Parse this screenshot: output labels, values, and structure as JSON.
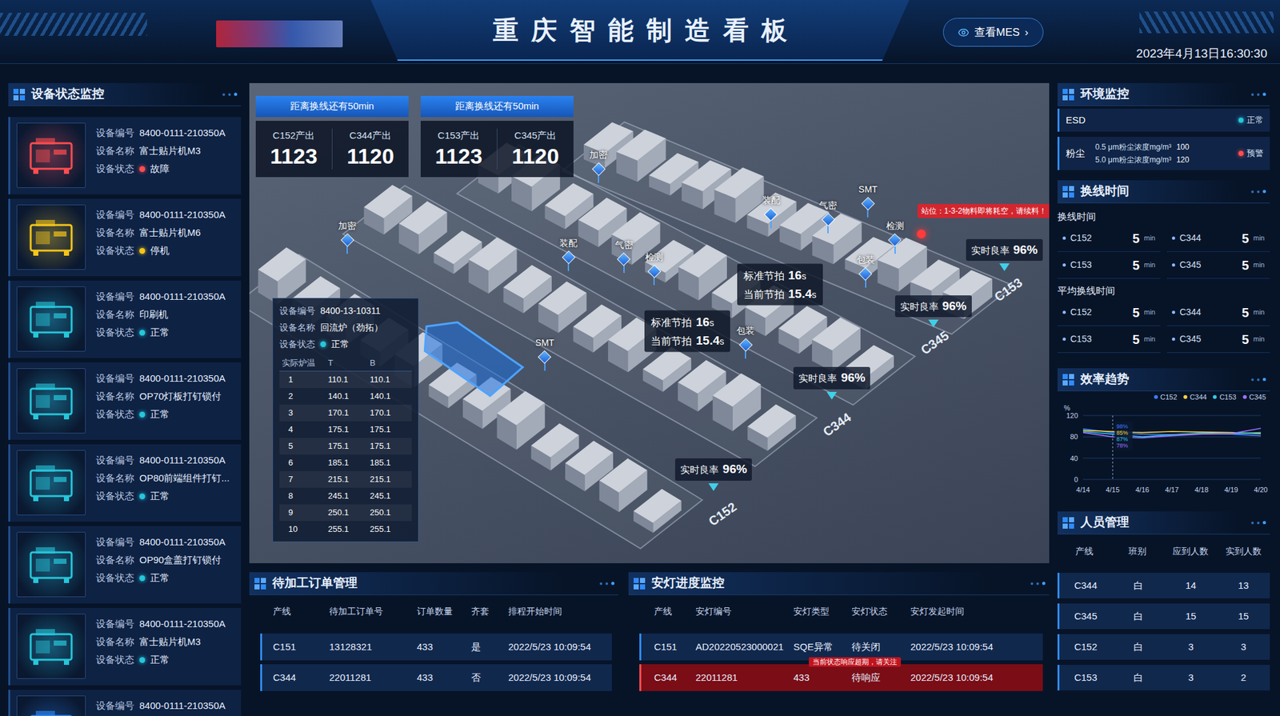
{
  "header": {
    "title": "重庆智能制造看板",
    "mes_button": {
      "label": "查看MES",
      "chevron": "›"
    },
    "datetime": "2023年4月13日16:30:30"
  },
  "device_panel": {
    "title": "设备状态监控",
    "labels": {
      "number": "设备编号",
      "name": "设备名称",
      "status": "设备状态"
    },
    "devices": [
      {
        "number": "8400-0111-210350A",
        "name": "富士贴片机M3",
        "status": "故障",
        "color": "#ff4d4f"
      },
      {
        "number": "8400-0111-210350A",
        "name": "富士贴片机M6",
        "status": "停机",
        "color": "#f5c518"
      },
      {
        "number": "8400-0111-210350A",
        "name": "印刷机",
        "status": "正常",
        "color": "#26c6da"
      },
      {
        "number": "8400-0111-210350A",
        "name": "OP70灯板打钉锁付",
        "status": "正常",
        "color": "#26c6da"
      },
      {
        "number": "8400-0111-210350A",
        "name": "OP80前端组件打钉...",
        "status": "正常",
        "color": "#26c6da"
      },
      {
        "number": "8400-0111-210350A",
        "name": "OP90盒盖打钉锁付",
        "status": "正常",
        "color": "#26c6da"
      },
      {
        "number": "8400-0111-210350A",
        "name": "富士贴片机M3",
        "status": "正常",
        "color": "#26c6da"
      },
      {
        "number": "8400-0111-210350A"
      }
    ]
  },
  "factory_view": {
    "countdowns": [
      {
        "title": "距离换线还有50min",
        "outputs": [
          {
            "label": "C152产出",
            "value": "1123"
          },
          {
            "label": "C344产出",
            "value": "1120"
          }
        ]
      },
      {
        "title": "距离换线还有50min",
        "outputs": [
          {
            "label": "C153产出",
            "value": "1123"
          },
          {
            "label": "C345产出",
            "value": "1120"
          }
        ]
      }
    ],
    "stations": [
      {
        "label": "加密"
      },
      {
        "label": "装配"
      },
      {
        "label": "气密"
      },
      {
        "label": "SMT"
      },
      {
        "label": "检测"
      },
      {
        "label": "包装"
      },
      {
        "label": "加密"
      },
      {
        "label": "装配"
      },
      {
        "label": "气密"
      },
      {
        "label": "检测"
      },
      {
        "label": "SMT"
      },
      {
        "label": "包装"
      }
    ],
    "lines": [
      {
        "name": "C153"
      },
      {
        "name": "C345"
      },
      {
        "name": "C344"
      },
      {
        "name": "C152"
      }
    ],
    "yields": [
      {
        "label": "实时良率",
        "value": "96%"
      },
      {
        "label": "实时良率",
        "value": "96%"
      },
      {
        "label": "实时良率",
        "value": "96%"
      },
      {
        "label": "实时良率",
        "value": "96%"
      }
    ],
    "takts": [
      {
        "standard_label": "标准节拍",
        "standard_value": "16",
        "current_label": "当前节拍",
        "current_value": "15.4",
        "unit": "s"
      },
      {
        "standard_label": "标准节拍",
        "standard_value": "16",
        "current_label": "当前节拍",
        "current_value": "15.4",
        "unit": "s"
      }
    ],
    "alert": {
      "text": "站位：1-3-2物料即将耗空，请续料！"
    },
    "equipment_tooltip": {
      "fields": [
        {
          "kind": "text",
          "label": "设备编号",
          "value": "8400-13-10311"
        },
        {
          "kind": "text",
          "label": "设备名称",
          "value": "回流炉（劲拓）"
        },
        {
          "kind": "status",
          "label": "设备状态",
          "value": "正常",
          "color": "#26c6da"
        }
      ],
      "columns": [
        "实际炉温",
        "T",
        "B"
      ],
      "rows": [
        [
          "1",
          "110.1",
          "110.1"
        ],
        [
          "2",
          "140.1",
          "140.1"
        ],
        [
          "3",
          "170.1",
          "170.1"
        ],
        [
          "4",
          "175.1",
          "175.1"
        ],
        [
          "5",
          "175.1",
          "175.1"
        ],
        [
          "6",
          "185.1",
          "185.1"
        ],
        [
          "7",
          "215.1",
          "215.1"
        ],
        [
          "8",
          "245.1",
          "245.1"
        ],
        [
          "9",
          "250.1",
          "250.1"
        ],
        [
          "10",
          "255.1",
          "255.1"
        ]
      ]
    }
  },
  "orders": {
    "title": "待加工订单管理",
    "columns": [
      "产线",
      "待加工订单号",
      "订单数量",
      "齐套",
      "排程开始时间"
    ],
    "rows": [
      [
        "C151",
        "13128321",
        "433",
        "是",
        "2022/5/23 10:09:54"
      ],
      [
        "C344",
        "22011281",
        "433",
        "否",
        "2022/5/23 10:09:54"
      ]
    ]
  },
  "andon": {
    "title": "安灯进度监控",
    "columns": [
      "产线",
      "安灯编号",
      "安灯类型",
      "安灯状态",
      "安灯发起时间"
    ],
    "rows": [
      {
        "cells": [
          "C151",
          "AD20220523000021",
          "SQE异常",
          "待关闭",
          "2022/5/23 10:09:54"
        ],
        "alert": false
      },
      {
        "cells": [
          "C344",
          "22011281",
          "433",
          "待响应",
          "2022/5/23 10:09:54"
        ],
        "alert": true,
        "note": "当前状态响应超期，请关注"
      }
    ]
  },
  "environment": {
    "title": "环境监控",
    "items": [
      {
        "kind": "simple",
        "label": "ESD",
        "status": "正常",
        "color": "#26c6da"
      },
      {
        "kind": "readings",
        "label": "粉尘",
        "readings": [
          {
            "label": "0.5 μm粉尘浓度mg/m³",
            "value": "100"
          },
          {
            "label": "5.0 μm粉尘浓度mg/m³",
            "value": "120"
          }
        ],
        "status": "预警",
        "color": "#ff4d4f"
      }
    ]
  },
  "changeover": {
    "title": "换线时间",
    "groups": [
      {
        "title": "换线时间",
        "items": [
          {
            "line": "C152",
            "value": "5",
            "unit": "min"
          },
          {
            "line": "C344",
            "value": "5",
            "unit": "min"
          },
          {
            "line": "C153",
            "value": "5",
            "unit": "min"
          },
          {
            "line": "C345",
            "value": "5",
            "unit": "min"
          }
        ]
      },
      {
        "title": "平均换线时间",
        "items": [
          {
            "line": "C152",
            "value": "5",
            "unit": "min"
          },
          {
            "line": "C344",
            "value": "5",
            "unit": "min"
          },
          {
            "line": "C153",
            "value": "5",
            "unit": "min"
          },
          {
            "line": "C345",
            "value": "5",
            "unit": "min"
          }
        ]
      }
    ]
  },
  "efficiency": {
    "title": "效率趋势",
    "y_unit": "%",
    "y_max": 120,
    "y_ticks": [
      "120",
      "80",
      "40",
      "0"
    ],
    "x_labels": [
      "4/14",
      "4/15",
      "4/16",
      "4/17",
      "4/18",
      "4/19",
      "4/20"
    ],
    "series": [
      {
        "name": "C152",
        "color": "#3d7bff",
        "values": [
          95,
          88,
          85,
          84,
          86,
          85,
          82
        ]
      },
      {
        "name": "C344",
        "color": "#f5d142",
        "values": [
          92,
          90,
          88,
          90,
          89,
          88,
          86
        ]
      },
      {
        "name": "C153",
        "color": "#36c6e8",
        "values": [
          90,
          85,
          80,
          84,
          87,
          86,
          88
        ]
      },
      {
        "name": "C345",
        "color": "#a070ff",
        "values": [
          88,
          80,
          78,
          82,
          85,
          86,
          96
        ]
      }
    ],
    "tooltip_index": 1,
    "tooltip": [
      "98%",
      "85%",
      "87%",
      "78%"
    ]
  },
  "personnel": {
    "title": "人员管理",
    "columns": [
      "产线",
      "班别",
      "应到人数",
      "实到人数"
    ],
    "rows": [
      [
        "C344",
        "白",
        "14",
        "13"
      ],
      [
        "C345",
        "白",
        "15",
        "15"
      ],
      [
        "C152",
        "白",
        "3",
        "3"
      ],
      [
        "C153",
        "白",
        "3",
        "2"
      ]
    ]
  }
}
